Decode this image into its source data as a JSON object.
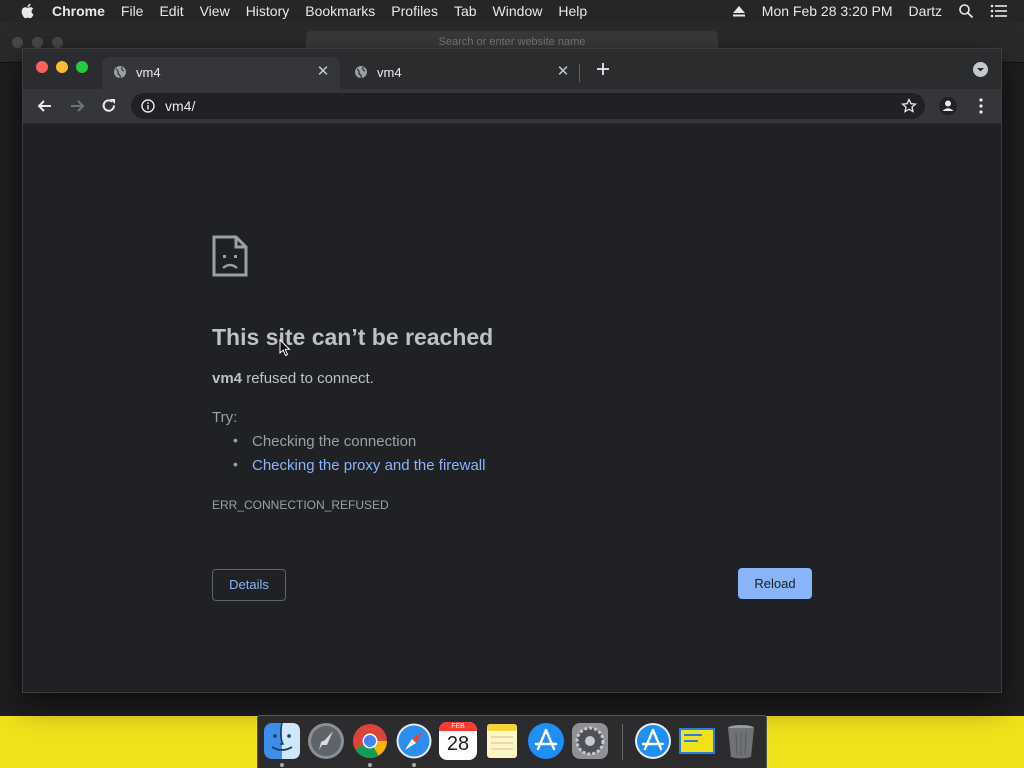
{
  "menubar": {
    "app_name": "Chrome",
    "items": [
      "File",
      "Edit",
      "View",
      "History",
      "Bookmarks",
      "Profiles",
      "Tab",
      "Window",
      "Help"
    ],
    "clock": "Mon Feb 28  3:20 PM",
    "user": "Dartz"
  },
  "background_window": {
    "search_placeholder": "Search or enter website name"
  },
  "browser": {
    "tabs": [
      {
        "title": "vm4",
        "active": true
      },
      {
        "title": "vm4",
        "active": false
      }
    ],
    "url": "vm4/"
  },
  "error_page": {
    "title": "This site can’t be reached",
    "host": "vm4",
    "description_suffix": " refused to connect.",
    "try_label": "Try:",
    "suggestions": [
      "Checking the connection",
      "Checking the proxy and the firewall"
    ],
    "error_code": "ERR_CONNECTION_REFUSED",
    "details_label": "Details",
    "reload_label": "Reload"
  },
  "dock": {
    "calendar_month": "FEB",
    "calendar_day": "28",
    "apps": [
      "finder-icon",
      "launchpad-icon",
      "chrome-icon",
      "safari-icon",
      "calendar-icon",
      "notes-icon",
      "app-store-icon",
      "system-preferences-icon",
      "app-store-download-icon",
      "preview-icon",
      "trash-icon"
    ]
  },
  "colors": {
    "desktop": "#f2e21c",
    "page_background": "#202124",
    "link": "#8ab4f8",
    "reload_button": "#8ab4f8"
  }
}
